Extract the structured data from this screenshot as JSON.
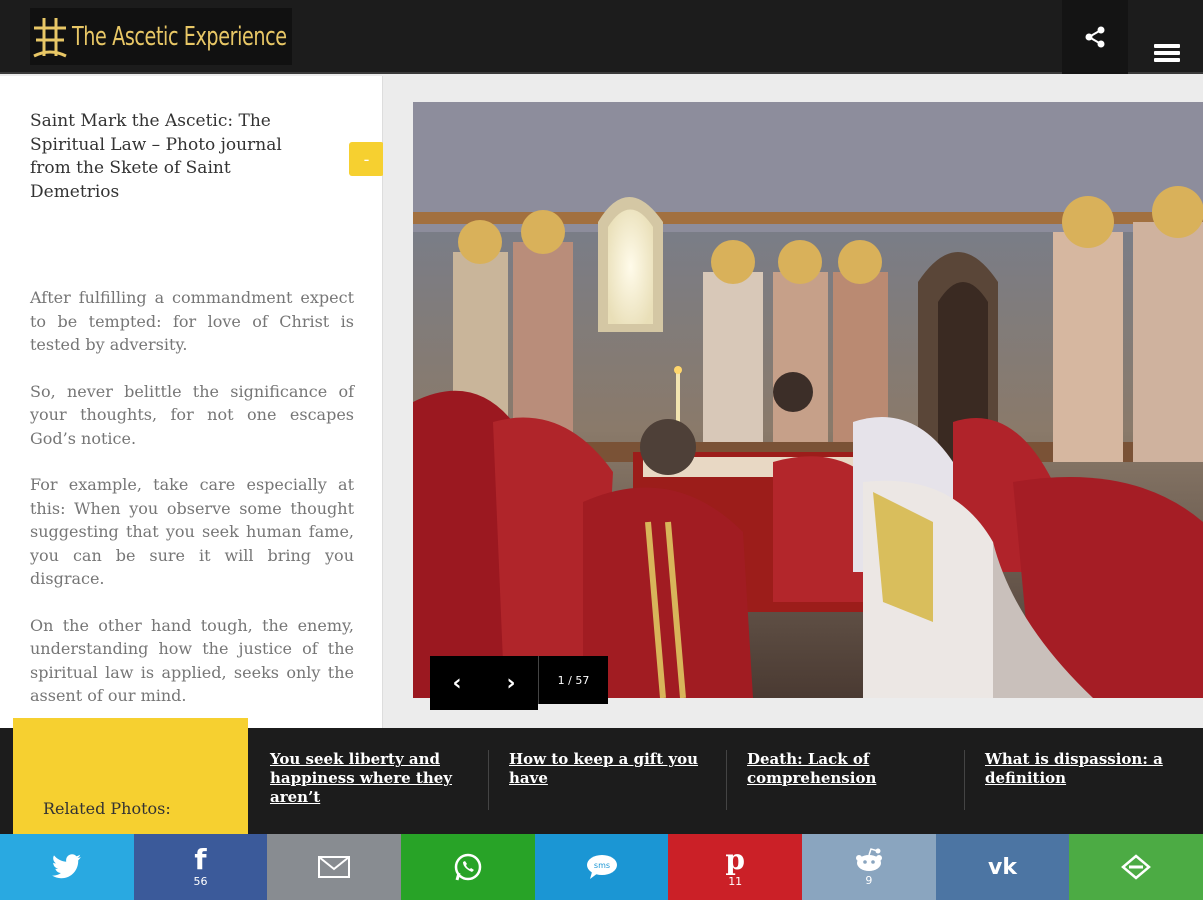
{
  "header": {
    "site_title": "The Ascetic Experience",
    "share_icon": "share-icon",
    "menu_icon": "hamburger-menu-icon"
  },
  "post": {
    "title": "Saint Mark the Ascetic: The Spiritual Law – Photo journal from the Skete of Saint Demetrios",
    "collapse_label": "-",
    "paragraphs": [
      "After fulfilling a commandment expect to be tempted: for love of Christ is tested by adversity.",
      "So, never belittle the significance of your thoughts, for not one escapes God’s notice.",
      "For example, take care especially at this: When you observe some thought suggesting that you seek human fame, you can be sure it will bring you disgrace.",
      "On the other hand tough, the enemy, understanding how the justice of the spiritual law is applied, seeks only the assent of our mind."
    ]
  },
  "gallery": {
    "prev_label": "‹",
    "next_label": "›",
    "counter": "1 / 57"
  },
  "related": {
    "label": "Related Photos:",
    "links": [
      "You seek liberty and happiness where they aren’t",
      "How to keep a gift you have",
      "Death: Lack of comprehension",
      "What is dispassion: a definition"
    ]
  },
  "share_bar": [
    {
      "name": "twitter",
      "icon": "twitter-icon",
      "color": "#29a9e1",
      "count": ""
    },
    {
      "name": "facebook",
      "icon": "facebook-icon",
      "color": "#3b5a9a",
      "count": "56"
    },
    {
      "name": "email",
      "icon": "email-icon",
      "color": "#888c91",
      "count": ""
    },
    {
      "name": "whatsapp",
      "icon": "whatsapp-icon",
      "color": "#28a327",
      "count": ""
    },
    {
      "name": "sms",
      "icon": "sms-icon",
      "color": "#1b96d4",
      "count": ""
    },
    {
      "name": "pinterest",
      "icon": "pinterest-icon",
      "color": "#cb2027",
      "count": "11"
    },
    {
      "name": "reddit",
      "icon": "reddit-icon",
      "color": "#8aa5bf",
      "count": "9"
    },
    {
      "name": "vk",
      "icon": "vk-icon",
      "color": "#4c75a3",
      "count": ""
    },
    {
      "name": "more",
      "icon": "more-share-icon",
      "color": "#4cab44",
      "count": ""
    }
  ],
  "colors": {
    "accent_yellow": "#f6d030",
    "header_bg": "#1c1c1c",
    "logo_gold": "#e8c766"
  }
}
